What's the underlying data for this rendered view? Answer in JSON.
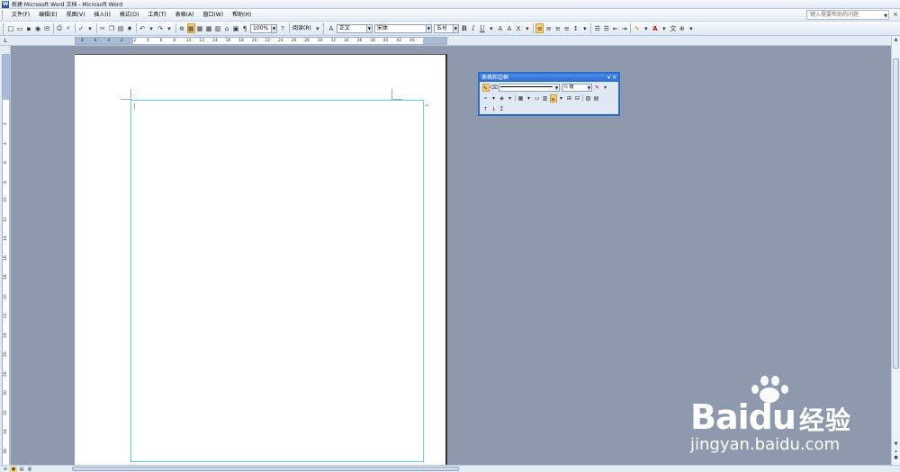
{
  "window": {
    "title": "新建 Microsoft Word 文档 - Microsoft Word",
    "app_icon": "W"
  },
  "menubar": {
    "items": [
      "文件(F)",
      "编辑(E)",
      "视图(V)",
      "插入(I)",
      "格式(O)",
      "工具(T)",
      "表格(A)",
      "窗口(W)",
      "帮助(H)"
    ],
    "help_placeholder": "键入需要帮助的问题",
    "close_glyph": "×"
  },
  "toolbar": {
    "zoom": "100%",
    "read_label": "阅读(R)",
    "style": "正文",
    "font": "宋体",
    "size": "五号",
    "bold": "B",
    "italic": "I",
    "underline": "U",
    "font_color_glyph": "A"
  },
  "ruler": {
    "corner": "L",
    "h_labels": [
      "8",
      "6",
      "4",
      "2",
      "2",
      "4",
      "6",
      "8",
      "10",
      "12",
      "14",
      "16",
      "18",
      "20",
      "22",
      "24",
      "26",
      "28",
      "30",
      "32",
      "34",
      "36",
      "38",
      "40",
      "42",
      "46"
    ],
    "v_labels": [
      "2",
      "4",
      "6",
      "8",
      "10",
      "12",
      "14",
      "16",
      "18",
      "20",
      "22",
      "24",
      "26",
      "28",
      "30",
      "32",
      "34",
      "36"
    ]
  },
  "document": {
    "cursor_glyph": "↵",
    "end_cell_mark": "↵",
    "paragraph_mark": "↵"
  },
  "tables_borders_toolbar": {
    "title": "表格和边框",
    "line_weight": "½ 磅",
    "menu_glyph": "▾",
    "close_glyph": "×",
    "sum_glyph": "Σ"
  },
  "status": {
    "view_icons": [
      "≡",
      "▣",
      "▤",
      "▥"
    ]
  },
  "watermark": {
    "brand": "Bai",
    "brand_du": "du",
    "brand_cn": "经验",
    "url": "jingyan.baidu.com"
  }
}
